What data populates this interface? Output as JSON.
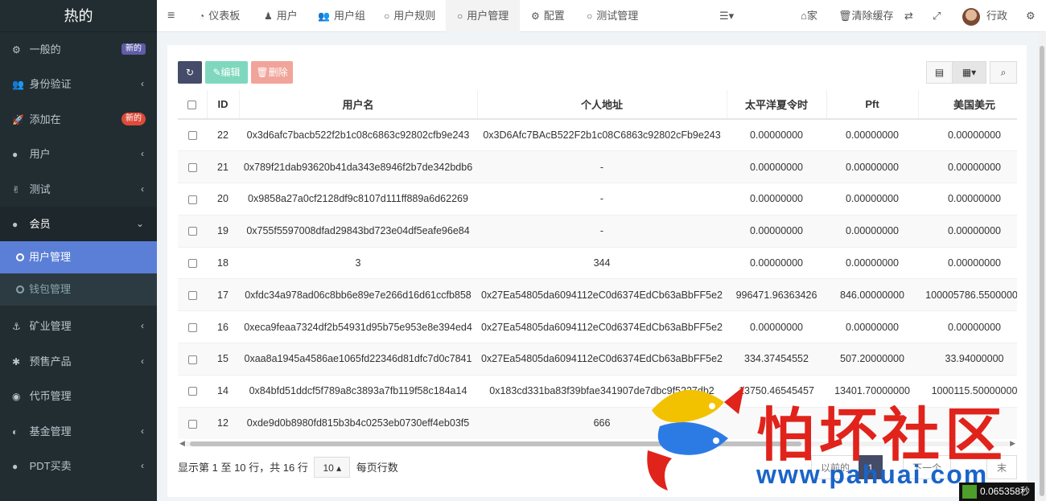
{
  "app": {
    "title": "热的"
  },
  "sidebar": {
    "items": [
      {
        "label": "一般的",
        "icon": "⚙",
        "badge": "新的",
        "badge_color": "#605ca8"
      },
      {
        "label": "身份验证",
        "icon": "👥",
        "chevron": "‹"
      },
      {
        "label": "添加在",
        "icon": "🚀",
        "badge": "新的",
        "badge_color": "#dd4b39"
      },
      {
        "label": "用户",
        "icon": "●",
        "chevron": "‹"
      },
      {
        "label": "测试",
        "icon": "✌",
        "chevron": "‹"
      },
      {
        "label": "会员",
        "icon": "●",
        "chevron": "⌄"
      }
    ],
    "subitems": [
      {
        "label": "用户管理",
        "active": true
      },
      {
        "label": "钱包管理",
        "active": false
      }
    ],
    "items2": [
      {
        "label": "矿业管理",
        "icon": "⚓",
        "chevron": "‹"
      },
      {
        "label": "预售产品",
        "icon": "✱",
        "chevron": "‹"
      },
      {
        "label": "代币管理",
        "icon": "◉"
      },
      {
        "label": "基金管理",
        "icon": "◐",
        "chevron": "‹"
      },
      {
        "label": "PDT买卖",
        "icon": "●",
        "chevron": "‹"
      }
    ]
  },
  "topnav": {
    "menu_icon": "≡",
    "tabs": [
      {
        "label": "仪表板",
        "icon": "◔"
      },
      {
        "label": "用户",
        "icon": "♟"
      },
      {
        "label": "用户组",
        "icon": "👥"
      },
      {
        "label": "用户规则",
        "icon": "○"
      },
      {
        "label": "用户管理",
        "icon": "○",
        "active": true
      },
      {
        "label": "配置",
        "icon": "⚙"
      },
      {
        "label": "测试管理",
        "icon": "○"
      }
    ],
    "more_icon": "☰▾",
    "home_label": "家",
    "home_icon": "⌂",
    "clear_cache_label": "清除缓存",
    "clear_cache_icon": "🗑",
    "translate_icon": "⇄",
    "fullscreen_icon": "⤢",
    "user_name": "行政",
    "settings_icon": "⚙"
  },
  "toolbar": {
    "refresh_icon": "↻",
    "edit_label": "✎编辑",
    "delete_label": "🗑删除",
    "columns_icon": "▤",
    "grid_icon": "▦▾",
    "search_icon": "⌕"
  },
  "table": {
    "headers": [
      "ID",
      "用户名",
      "个人地址",
      "太平洋夏令时",
      "Pft",
      "美国美元"
    ],
    "rows": [
      [
        "22",
        "0x3d6afc7bacb522f2b1c08c6863c92802cfb9e243",
        "0x3D6Afc7BAcB522F2b1c08C6863c92802cFb9e243",
        "0.00000000",
        "0.00000000",
        "0.00000000"
      ],
      [
        "21",
        "0x789f21dab93620b41da343e8946f2b7de342bdb6",
        "-",
        "0.00000000",
        "0.00000000",
        "0.00000000"
      ],
      [
        "20",
        "0x9858a27a0cf2128df9c8107d111ff889a6d62269",
        "-",
        "0.00000000",
        "0.00000000",
        "0.00000000"
      ],
      [
        "19",
        "0x755f5597008dfad29843bd723e04df5eafe96e84",
        "-",
        "0.00000000",
        "0.00000000",
        "0.00000000"
      ],
      [
        "18",
        "3",
        "344",
        "0.00000000",
        "0.00000000",
        "0.00000000"
      ],
      [
        "17",
        "0xfdc34a978ad06c8bb6e89e7e266d16d61ccfb858",
        "0x27Ea54805da6094112eC0d6374EdCb63aBbFF5e2",
        "996471.96363426",
        "846.00000000",
        "100005786.55000000"
      ],
      [
        "16",
        "0xeca9feaa7324df2b54931d95b75e953e8e394ed4",
        "0x27Ea54805da6094112eC0d6374EdCb63aBbFF5e2",
        "0.00000000",
        "0.00000000",
        "0.00000000"
      ],
      [
        "15",
        "0xaa8a1945a4586ae1065fd22346d81dfc7d0c7841",
        "0x27Ea54805da6094112eC0d6374EdCb63aBbFF5e2",
        "334.37454552",
        "507.20000000",
        "33.94000000"
      ],
      [
        "14",
        "0x84bfd51ddcf5f789a8c3893a7fb119f58c184a14",
        "0x183cd331ba83f39bfae341907de7dbc9f5227db2",
        "13750.46545457",
        "13401.70000000",
        "1000115.50000000"
      ],
      [
        "12",
        "0xde9d0b8980fd815b3b4c0253eb0730eff4eb03f5",
        "666",
        "",
        "",
        ""
      ]
    ]
  },
  "pagination": {
    "summary": "显示第 1 至 10 行，共 16 行",
    "page_size": "10 ▴",
    "per_page_label": "每页行数",
    "prev_label": "以前的",
    "current_page": "1",
    "next_label": "下一个",
    "last_label": "末"
  },
  "watermark": {
    "text": "怕坏社区",
    "url": "www.pahuai.com"
  },
  "timer": "0.065358秒"
}
